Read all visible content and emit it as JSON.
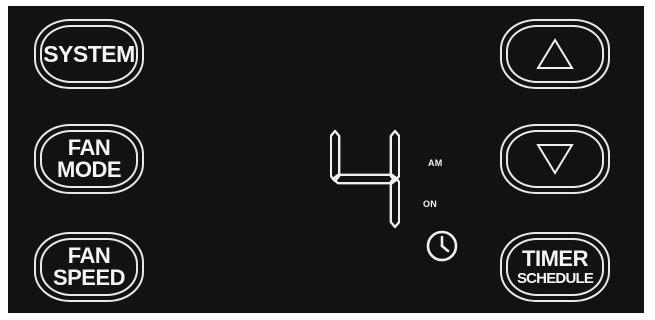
{
  "buttons": {
    "system": "SYSTEM",
    "fan_mode_line1": "FAN",
    "fan_mode_line2": "MODE",
    "fan_speed_line1": "FAN",
    "fan_speed_line2": "SPEED",
    "timer_line1": "TIMER",
    "timer_line2": "SCHEDULE"
  },
  "display": {
    "digit": "4",
    "am_indicator": "AM",
    "on_indicator": "ON"
  },
  "icons": {
    "up": "up-triangle-icon",
    "down": "down-triangle-icon",
    "clock": "clock-icon"
  },
  "colors": {
    "panel": "#121212",
    "foreground": "#f0f0f0"
  }
}
